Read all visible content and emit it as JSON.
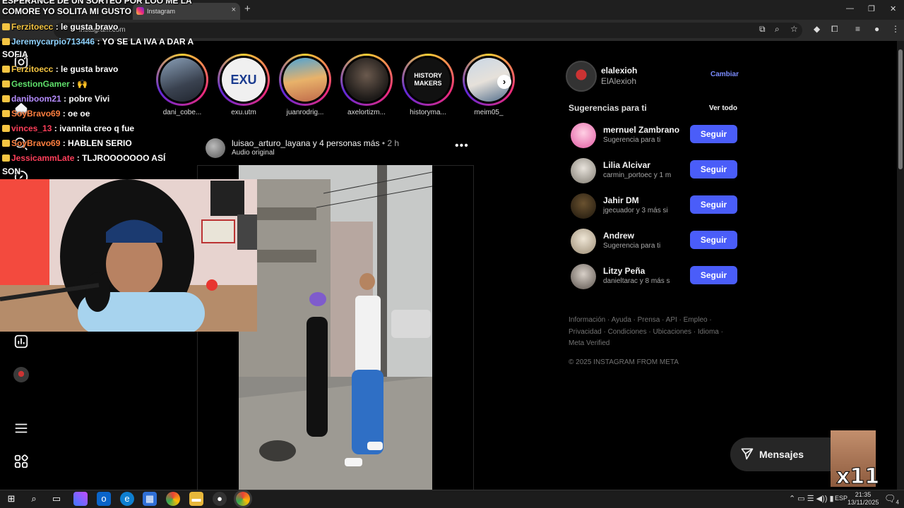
{
  "browser": {
    "tab_title": "Instagram",
    "tab_close": "×",
    "new_tab": "+",
    "url": "instagram.com",
    "window_controls": [
      "—",
      "❐",
      "✕"
    ]
  },
  "stories": [
    {
      "name": "dani_cobe..."
    },
    {
      "name": "exu.utm",
      "logo_text": "EXU"
    },
    {
      "name": "juanrodrig..."
    },
    {
      "name": "axelortizm..."
    },
    {
      "name": "historyma...",
      "logo_text": "HISTORY MAKERS"
    },
    {
      "name": "meim05_"
    }
  ],
  "story_next": "›",
  "post": {
    "author": "luisao_arturo_layana",
    "others": "y 4 personas más",
    "time": " • 2 h",
    "audio": "Audio original",
    "menu": "•••"
  },
  "profile": {
    "username": "elalexioh",
    "name": "ElAlexioh",
    "switch_label": "Cambiar"
  },
  "suggestions": {
    "title": "Sugerencias para ti",
    "see_all": "Ver todo",
    "follow_label": "Seguir",
    "items": [
      {
        "name": "mernuel Zambrano",
        "sub": "Sugerencia para ti"
      },
      {
        "name": "Lilia Alcivar",
        "sub": "carmin_portoec y 1 m"
      },
      {
        "name": "Jahir DM",
        "sub": "jgecuador y 3 más si"
      },
      {
        "name": "Andrew",
        "sub": "Sugerencia para ti"
      },
      {
        "name": "Litzy Peña",
        "sub": "danieltarac y 8 más s"
      }
    ]
  },
  "footer": {
    "links": "Información · Ayuda · Prensa · API · Empleo · Privacidad · Condiciones · Ubicaciones · Idioma · Meta Verified",
    "copyright": "© 2025 INSTAGRAM FROM META"
  },
  "messages": {
    "label": "Mensajes",
    "overlay_text": "x11"
  },
  "chat": [
    {
      "user": "",
      "text": "ESPERANCE DE UN SORTEO POR LOO ME LA",
      "color": "#ffffff"
    },
    {
      "user": "",
      "text": "COMORE YO SOLITA MI GUSTO",
      "color": "#ffffff"
    },
    {
      "user": "Ferzitoecc",
      "text": ": le gusta bravo",
      "color": "#f5c542"
    },
    {
      "user": "Jeremycarpio713446",
      "text": ": YO SE LA IVA A DAR A",
      "color": "#8fd3ff"
    },
    {
      "user": "",
      "text": "SOFIA",
      "color": "#ffffff"
    },
    {
      "user": "Ferzitoecc",
      "text": ": le gusta bravo",
      "color": "#f5c542"
    },
    {
      "user": "GestionGamer",
      "text": ": 🙌",
      "color": "#5fe06b"
    },
    {
      "user": "daniboom21",
      "text": ": pobre Vivi",
      "color": "#b58cff"
    },
    {
      "user": "SoyBravo69",
      "text": ": oe oe",
      "color": "#ff7f3f"
    },
    {
      "user": "vinces_13",
      "text": ": ivannita creo q fue",
      "color": "#ff3f5a"
    },
    {
      "user": "SoyBravo69",
      "text": ": HABLEN SERIO",
      "color": "#ff7f3f"
    },
    {
      "user": "JessicammLate",
      "text": ": TLJROOOOOOO ASÍ",
      "color": "#ff3f5a"
    },
    {
      "user": "",
      "text": "SON",
      "color": "#ffffff"
    }
  ],
  "taskbar": {
    "language": "ESP",
    "time": "21:35",
    "date": "13/11/2025",
    "notifications": "4"
  },
  "colors": {
    "accent": "#4a5df9",
    "link": "#7b8cff",
    "background": "#000000",
    "muted": "#a8a8a8"
  }
}
